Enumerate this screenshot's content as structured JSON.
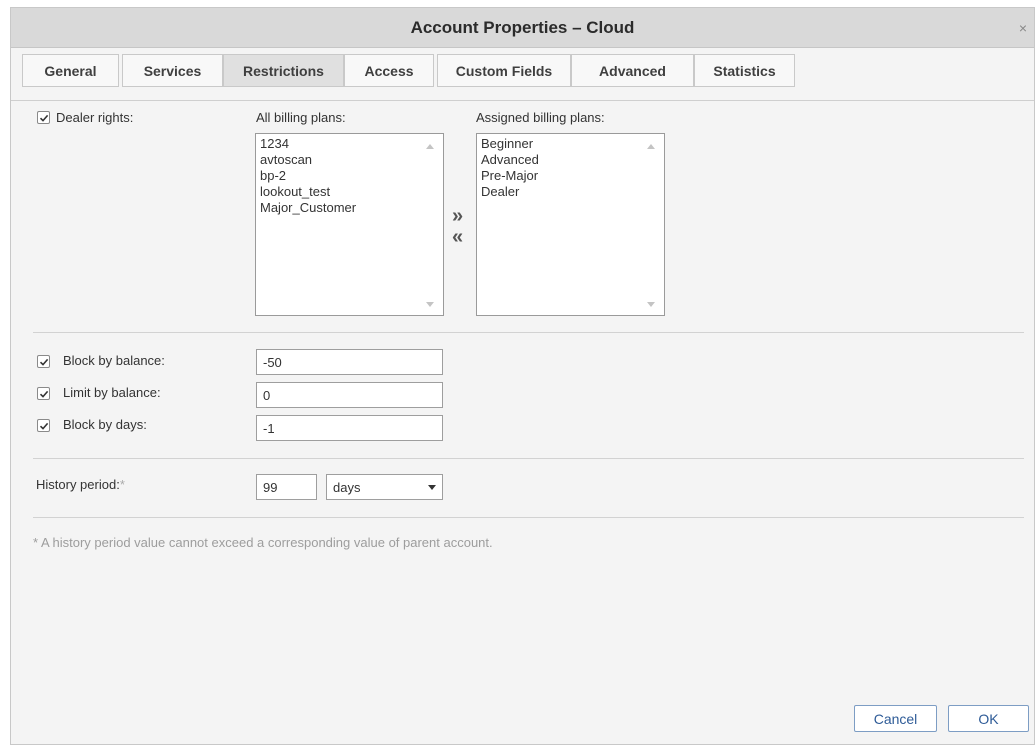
{
  "window": {
    "title": "Account Properties – Cloud",
    "close_glyph": "×"
  },
  "tabs": [
    {
      "label": "General"
    },
    {
      "label": "Services"
    },
    {
      "label": "Restrictions"
    },
    {
      "label": "Access"
    },
    {
      "label": "Custom Fields"
    },
    {
      "label": "Advanced"
    },
    {
      "label": "Statistics"
    }
  ],
  "active_tab": "Restrictions",
  "dealer_rights": {
    "label": "Dealer rights:",
    "checked": true
  },
  "all_plans": {
    "label": "All billing plans:",
    "items": [
      "1234",
      "avtoscan",
      "bp-2",
      "lookout_test",
      "Major_Customer"
    ]
  },
  "assigned_plans": {
    "label": "Assigned billing plans:",
    "items": [
      "Beginner",
      "Advanced",
      "Pre-Major",
      "Dealer"
    ]
  },
  "move_buttons": {
    "add": "»",
    "remove": "«"
  },
  "block_by_balance": {
    "label": "Block by balance:",
    "checked": true,
    "value": "-50"
  },
  "limit_by_balance": {
    "label": "Limit by balance:",
    "checked": true,
    "value": "0"
  },
  "block_by_days": {
    "label": "Block by days:",
    "checked": true,
    "value": "-1"
  },
  "history_period": {
    "label": "History period:",
    "required_mark": "*",
    "value": "99",
    "unit": "days"
  },
  "footnote": "* A history period value cannot exceed a corresponding value of parent account.",
  "buttons": {
    "cancel": "Cancel",
    "ok": "OK"
  },
  "icons": {
    "checkbox": "check-icon",
    "close": "close-icon"
  }
}
